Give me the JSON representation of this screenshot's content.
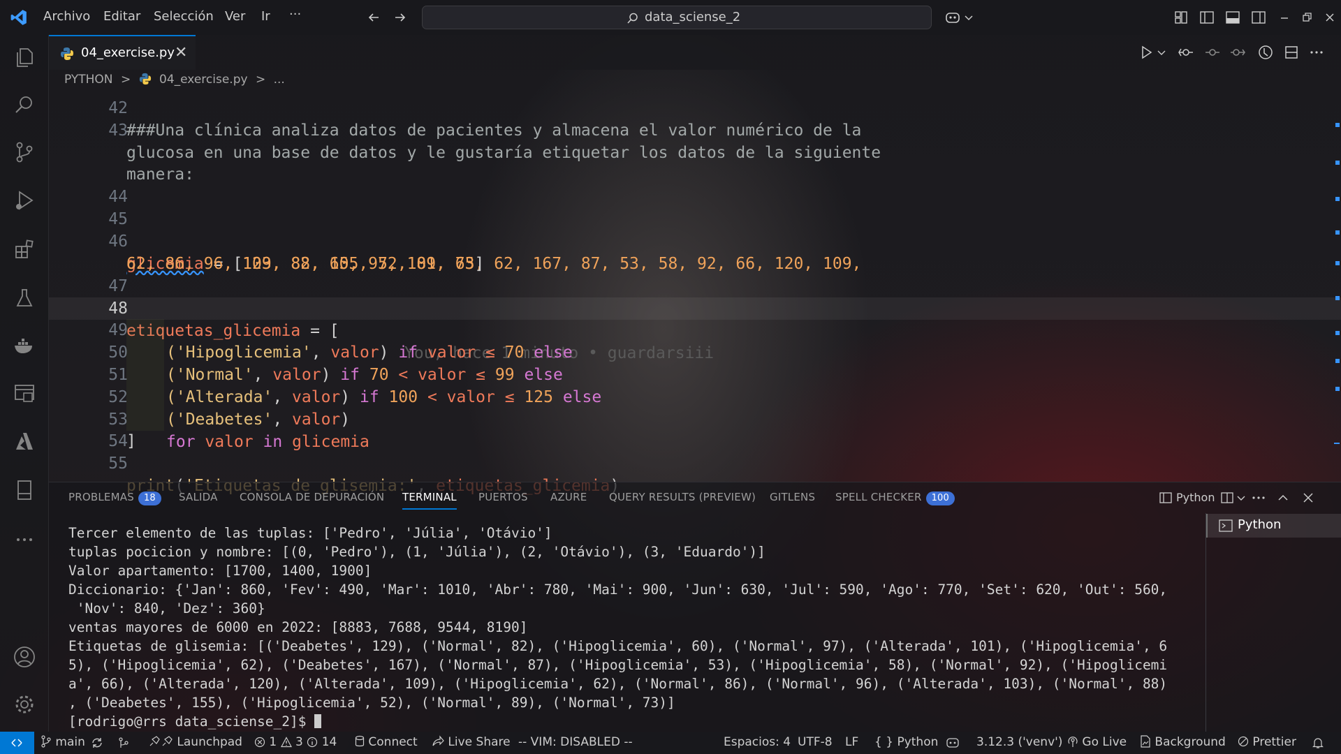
{
  "menu": {
    "items": [
      "Archivo",
      "Editar",
      "Selección",
      "Ver",
      "Ir",
      "···"
    ]
  },
  "search": {
    "text": "data_sciense_2"
  },
  "tab": {
    "label": "04_exercise.py",
    "close": "✕"
  },
  "breadcrumb": {
    "folder": "PYTHON",
    "sep": ">",
    "file": "04_exercise.py",
    "more": "..."
  },
  "editor": {
    "line_numbers": [
      "42",
      "43",
      "",
      "",
      "44",
      "45",
      "46",
      "",
      "47",
      "48",
      "49",
      "50",
      "51",
      "52",
      "53",
      "54",
      "55"
    ],
    "l43a": "###Una clínica analiza datos de pacientes y almacena el valor numérico de la",
    "l43b": "glucosa en una base de datos y le gustaría etiquetar los datos de la siguiente",
    "l43c": "manera:",
    "l46_var": "glicemia",
    "l46_rest": " = [",
    "l46_nums1": "129, 82, 60, 97, 101, 65, 62, 167, 87, 53, 58, 92, 66, 120, 109,",
    "l46_nums2": "62, 86, 96, 103, 88, 155, 52, 89, 73",
    "l46_close": "]",
    "l48_var": "etiquetas_glicemia",
    "l48_rest": " = [",
    "blame": "You, hace 1 minuto • guardarsiii",
    "l49": {
      "s": "('Hipoglicemia'",
      "v": "valor",
      "if": "if",
      "cond": "valor ≤ ",
      "n": "70",
      "else": "else"
    },
    "l50": {
      "s": "('Normal'",
      "v": "valor",
      "if": "if",
      "n1": "70",
      "mid": " < valor ≤ ",
      "n2": "99",
      "else": "else"
    },
    "l51": {
      "s": "('Alterada'",
      "v": "valor",
      "if": "if",
      "n1": "100",
      "mid": " < valor ≤ ",
      "n2": "125",
      "else": "else"
    },
    "l52": {
      "s": "('Deabetes'",
      "v": "valor"
    },
    "l53": {
      "for": "for",
      "v": "valor",
      "in": "in",
      "src": "glicemia"
    },
    "l54": "]",
    "l55": {
      "fn": "print",
      "s": "'Etiquetas de glisemia:'",
      "v": "etiquetas_glicemia"
    }
  },
  "panel": {
    "tabs": [
      "PROBLEMAS",
      "SALIDA",
      "CONSOLA DE DEPURACIÓN",
      "TERMINAL",
      "PUERTOS",
      "AZURE",
      "QUERY RESULTS (PREVIEW)",
      "GITLENS",
      "SPELL CHECKER"
    ],
    "problems_count": "18",
    "spell_count": "100",
    "shell_label": "Python",
    "terminal_list_item": "Python"
  },
  "terminal": {
    "lines": [
      "Tercer elemento de las tuplas: ['Pedro', 'Júlia', 'Otávio']",
      "tuplas pocicion y nombre: [(0, 'Pedro'), (1, 'Júlia'), (2, 'Otávio'), (3, 'Eduardo')]",
      "Valor apartamento: [1700, 1400, 1900]",
      "Diccionario: {'Jan': 860, 'Fev': 490, 'Mar': 1010, 'Abr': 780, 'Mai': 900, 'Jun': 630, 'Jul': 590, 'Ago': 770, 'Set': 620, 'Out': 560,",
      " 'Nov': 840, 'Dez': 360}",
      "ventas mayores de 6000 en 2022: [8883, 7688, 9544, 8190]",
      "Etiquetas de glisemia: [('Deabetes', 129), ('Normal', 82), ('Hipoglicemia', 60), ('Normal', 97), ('Alterada', 101), ('Hipoglicemia', 6",
      "5), ('Hipoglicemia', 62), ('Deabetes', 167), ('Normal', 87), ('Hipoglicemia', 53), ('Hipoglicemia', 58), ('Normal', 92), ('Hipoglicemi",
      "a', 66), ('Alterada', 120), ('Alterada', 109), ('Hipoglicemia', 62), ('Normal', 86), ('Normal', 96), ('Alterada', 103), ('Normal', 88)",
      ", ('Deabetes', 155), ('Hipoglicemia', 52), ('Normal', 89), ('Normal', 73)]",
      "[rodrigo@rrs data_sciense_2]$ "
    ]
  },
  "status": {
    "branch": "main",
    "launchpad": "Launchpad",
    "errors": "1",
    "warnings": "3",
    "infos": "14",
    "connect": "Connect",
    "liveshare": "Live Share",
    "vim": "-- VIM: DISABLED --",
    "spaces": "Espacios: 4",
    "encoding": "UTF-8",
    "eol": "LF",
    "lang_braces": "{ }",
    "language": "Python",
    "interpreter": "3.12.3 ('venv')",
    "golive": "Go Live",
    "background": "Background",
    "prettier": "Prettier"
  },
  "colors": {
    "accent": "#0078d4",
    "badge": "#3d70d6"
  }
}
